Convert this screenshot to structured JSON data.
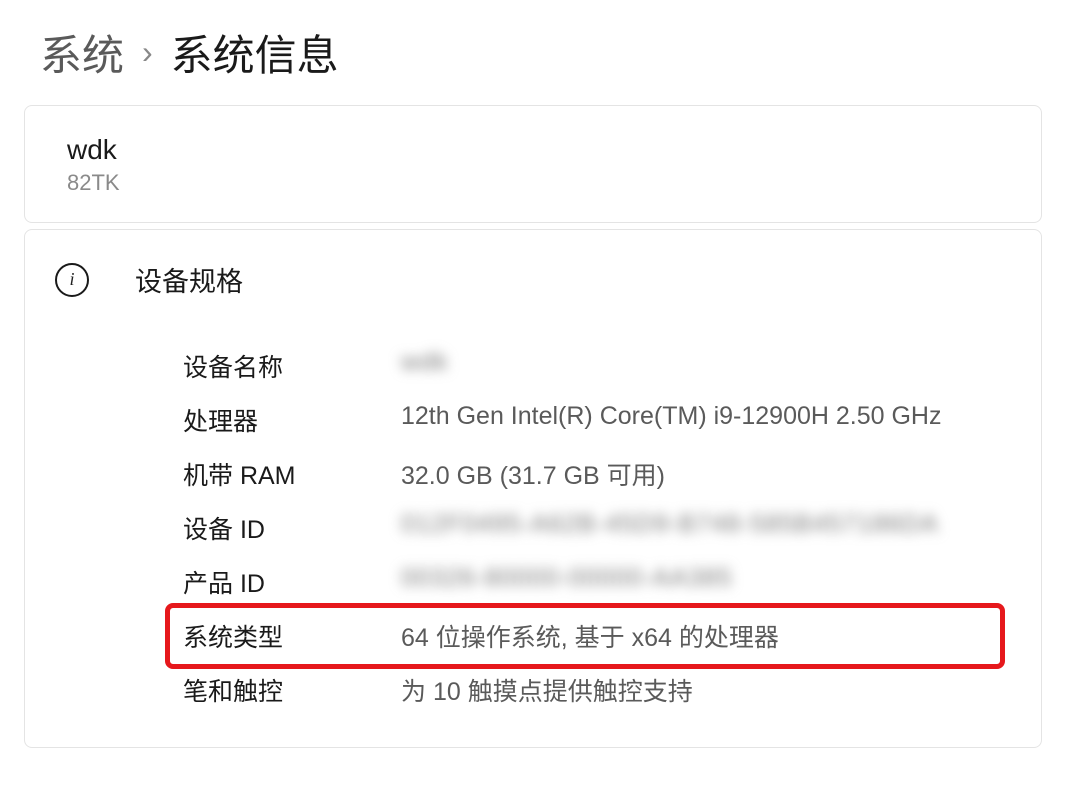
{
  "breadcrumb": {
    "parent": "系统",
    "current": "系统信息"
  },
  "device": {
    "name": "wdk",
    "model": "82TK"
  },
  "spec_section": {
    "title": "设备规格",
    "rows": [
      {
        "label": "设备名称",
        "value": "wdk",
        "blurred": true
      },
      {
        "label": "处理器",
        "value": "12th Gen Intel(R) Core(TM) i9-12900H   2.50 GHz",
        "blurred": false
      },
      {
        "label": "机带 RAM",
        "value": "32.0 GB (31.7 GB 可用)",
        "blurred": false
      },
      {
        "label": "设备 ID",
        "value": "012F0495-A62B-45D9-B748-585B457186DA",
        "blurred": true
      },
      {
        "label": "产品 ID",
        "value": "00326-80000-00000-AA385",
        "blurred": true
      },
      {
        "label": "系统类型",
        "value": "64 位操作系统, 基于 x64 的处理器",
        "blurred": false,
        "highlighted": true
      },
      {
        "label": "笔和触控",
        "value": "为 10 触摸点提供触控支持",
        "blurred": false
      }
    ]
  }
}
